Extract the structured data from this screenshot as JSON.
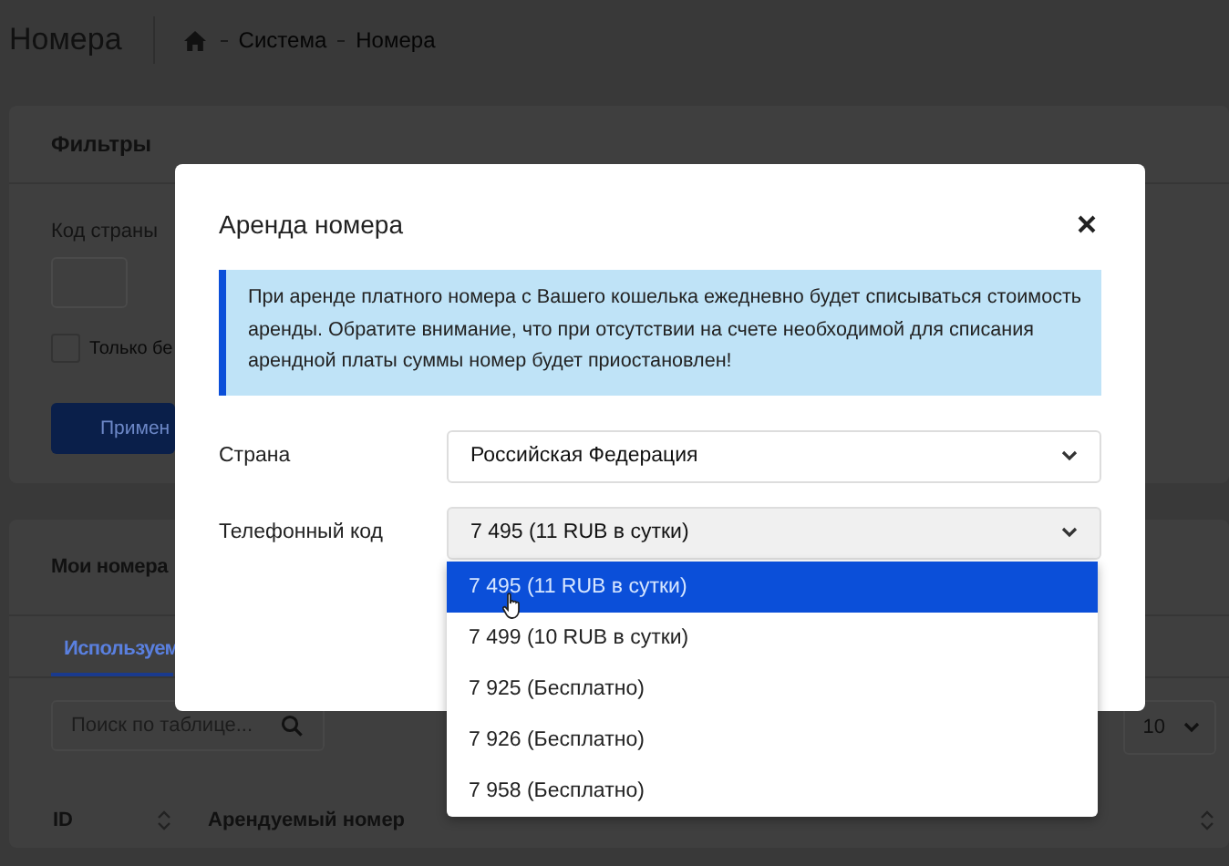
{
  "header": {
    "title": "Номера",
    "breadcrumb": [
      "Система",
      "Номера"
    ]
  },
  "filters": {
    "title": "Фильтры",
    "country_code_label": "Код страны",
    "checkbox": {
      "label": "Только бе",
      "checked": false
    },
    "apply_button": "Примен"
  },
  "my_numbers": {
    "title": "Мои номера",
    "tabs": [
      {
        "label": "Используем",
        "selected": true
      }
    ],
    "search": {
      "placeholder": "Поиск по таблице..."
    },
    "page_size": "10",
    "table": {
      "columns": [
        "ID",
        "Арендуемый номер"
      ]
    }
  },
  "modal": {
    "title": "Аренда номера",
    "alert": "При аренде платного номера с Вашего кошелька ежедневно будет списываться стоимость аренды. Обратите внимание, что при отсутствии на счете необходимой для списания арендной платы суммы номер будет приостановлен!",
    "fields": [
      {
        "label": "Страна",
        "value": "Российская Федерация",
        "focused": false
      },
      {
        "label": "Телефонный код",
        "value": "7 495 (11 RUB в сутки)",
        "focused": true,
        "options": [
          {
            "label": "7 495 (11 RUB в сутки)",
            "selected": true
          },
          {
            "label": "7 499 (10 RUB в сутки)",
            "selected": false
          },
          {
            "label": "7 925 (Бесплатно)",
            "selected": false
          },
          {
            "label": "7 926 (Бесплатно)",
            "selected": false
          },
          {
            "label": "7 958 (Бесплатно)",
            "selected": false
          }
        ]
      }
    ]
  }
}
